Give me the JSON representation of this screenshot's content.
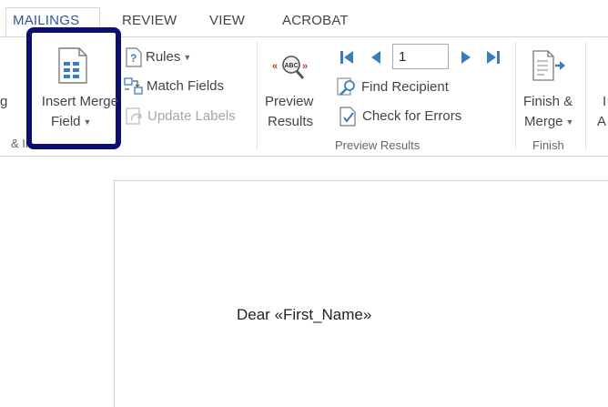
{
  "tabs": {
    "mailings": "MAILINGS",
    "review": "REVIEW",
    "view": "VIEW",
    "acrobat": "ACROBAT"
  },
  "ribbon": {
    "write_insert": {
      "cut_label_left": "g",
      "insert_merge_field_line1": "Insert Merge",
      "insert_merge_field_line2": "Field",
      "rules": "Rules",
      "match_fields": "Match Fields",
      "update_labels": "Update Labels",
      "group_label": "& Insert Fields"
    },
    "preview": {
      "preview_results_line1": "Preview",
      "preview_results_line2": "Results",
      "record_number": "1",
      "find_recipient": "Find Recipient",
      "check_for_errors": "Check for Errors",
      "group_label": "Preview Results"
    },
    "finish": {
      "finish_merge_line1": "Finish &",
      "finish_merge_line2": "Merge",
      "group_label": "Finish",
      "cut_label_right_1": "I",
      "cut_label_right_2": "A"
    }
  },
  "document": {
    "body_text": "Dear «First_Name»"
  },
  "colors": {
    "highlight": "#0d0f6e",
    "accent_blue": "#2b579a",
    "nav_arrow": "#3a7cc0"
  }
}
